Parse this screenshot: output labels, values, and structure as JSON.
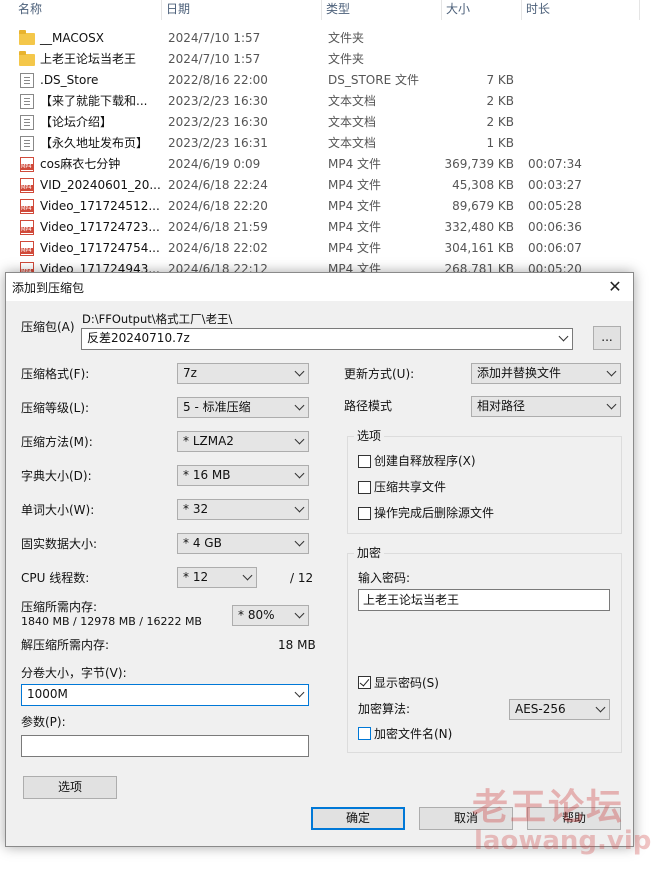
{
  "explorer": {
    "columns": [
      "名称",
      "日期",
      "类型",
      "大小",
      "时长"
    ],
    "files": [
      {
        "name": "__MACOSX",
        "date": "2024/7/10 1:57",
        "type": "文件夹",
        "size": "",
        "duration": "",
        "icon": "folder-icon"
      },
      {
        "name": "上老王论坛当老王",
        "date": "2024/7/10 1:57",
        "type": "文件夹",
        "size": "",
        "duration": "",
        "icon": "folder-icon"
      },
      {
        "name": ".DS_Store",
        "date": "2022/8/16 22:00",
        "type": "DS_STORE 文件",
        "size": "7 KB",
        "duration": "",
        "icon": "document-icon"
      },
      {
        "name": "【来了就能下载和...",
        "date": "2023/2/23 16:30",
        "type": "文本文档",
        "size": "2 KB",
        "duration": "",
        "icon": "document-icon"
      },
      {
        "name": "【论坛介绍】",
        "date": "2023/2/23 16:30",
        "type": "文本文档",
        "size": "2 KB",
        "duration": "",
        "icon": "document-icon"
      },
      {
        "name": "【永久地址发布页】",
        "date": "2023/2/23 16:31",
        "type": "文本文档",
        "size": "1 KB",
        "duration": "",
        "icon": "document-icon"
      },
      {
        "name": "cos麻衣七分钟",
        "date": "2024/6/19 0:09",
        "type": "MP4 文件",
        "size": "369,739 KB",
        "duration": "00:07:34",
        "icon": "mp4-icon"
      },
      {
        "name": "VID_20240601_20...",
        "date": "2024/6/18 22:24",
        "type": "MP4 文件",
        "size": "45,308 KB",
        "duration": "00:03:27",
        "icon": "mp4-icon"
      },
      {
        "name": "Video_171724512...",
        "date": "2024/6/18 22:20",
        "type": "MP4 文件",
        "size": "89,679 KB",
        "duration": "00:05:28",
        "icon": "mp4-icon"
      },
      {
        "name": "Video_171724723...",
        "date": "2024/6/18 21:59",
        "type": "MP4 文件",
        "size": "332,480 KB",
        "duration": "00:06:36",
        "icon": "mp4-icon"
      },
      {
        "name": "Video_171724754...",
        "date": "2024/6/18 22:02",
        "type": "MP4 文件",
        "size": "304,161 KB",
        "duration": "00:06:07",
        "icon": "mp4-icon"
      },
      {
        "name": "Video_171724943...",
        "date": "2024/6/18 22:12",
        "type": "MP4 文件",
        "size": "268,781 KB",
        "duration": "00:05:20",
        "icon": "mp4-icon"
      }
    ]
  },
  "dialog": {
    "title": "添加到压缩包",
    "close": "✕",
    "archive": {
      "label": "压缩包(A)",
      "path": "D:\\FFOutput\\格式工厂\\老王\\",
      "filename": "反差20240710.7z",
      "browse": "..."
    },
    "format": {
      "label": "压缩格式(F):",
      "value": "7z"
    },
    "level": {
      "label": "压缩等级(L):",
      "value": "5 - 标准压缩"
    },
    "method": {
      "label": "压缩方法(M):",
      "value": "*  LZMA2"
    },
    "dict": {
      "label": "字典大小(D):",
      "value": "*  16 MB"
    },
    "word": {
      "label": "单词大小(W):",
      "value": "*  32"
    },
    "solid": {
      "label": "固实数据大小:",
      "value": "*  4 GB"
    },
    "cpu": {
      "label": "CPU 线程数:",
      "value": "*  12",
      "total": "/ 12"
    },
    "memory": {
      "label": "压缩所需内存:",
      "detail": "1840 MB / 12978 MB / 16222 MB",
      "value": "* 80%"
    },
    "decompress": {
      "label": "解压缩所需内存:",
      "value": "18 MB"
    },
    "volume": {
      "label": "分卷大小，字节(V):",
      "value": "1000M"
    },
    "params": {
      "label": "参数(P):",
      "value": ""
    },
    "update": {
      "label": "更新方式(U):",
      "value": "添加并替换文件"
    },
    "pathmode": {
      "label": "路径模式",
      "value": "相对路径"
    },
    "options": {
      "title": "选项",
      "items": [
        {
          "label": "创建自释放程序(X)",
          "checked": false
        },
        {
          "label": "压缩共享文件",
          "checked": false
        },
        {
          "label": "操作完成后删除源文件",
          "checked": false
        }
      ]
    },
    "encryption": {
      "title": "加密",
      "password_label": "输入密码:",
      "password": "上老王论坛当老王",
      "show_password": "显示密码(S)",
      "method_label": "加密算法:",
      "method": "AES-256",
      "encrypt_names": "加密文件名(N)"
    },
    "buttons": {
      "options": "选项",
      "ok": "确定",
      "cancel": "取消",
      "help": "帮助"
    }
  },
  "watermark": {
    "line1": "老王论坛",
    "line2": "laowang.vip"
  }
}
